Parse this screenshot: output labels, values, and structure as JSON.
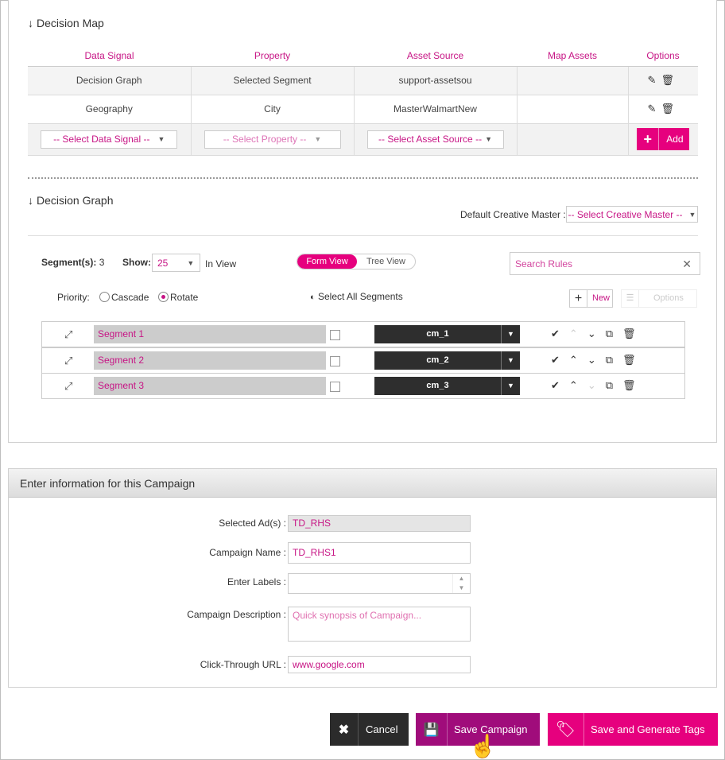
{
  "decision_map": {
    "title": "Decision Map",
    "columns": [
      "Data Signal",
      "Property",
      "Asset Source",
      "Map Assets",
      "Options"
    ],
    "rows": [
      {
        "signal": "Decision Graph",
        "property": "Selected Segment",
        "source": "support-assetsou",
        "map": ""
      },
      {
        "signal": "Geography",
        "property": "City",
        "source": "MasterWalmartNew",
        "map": ""
      }
    ],
    "select_signal": "-- Select Data Signal --",
    "select_property": "-- Select Property --",
    "select_source": "-- Select Asset Source --",
    "add_label": "Add"
  },
  "decision_graph": {
    "title": "Decision Graph",
    "default_master_label": "Default Creative Master :",
    "default_master_value": "-- Select Creative Master --",
    "segments_label": "Segment(s):",
    "segments_count": "3",
    "show_label": "Show:",
    "show_value": "25",
    "in_view": "In View",
    "form_view": "Form View",
    "tree_view": "Tree View",
    "search_placeholder": "Search Rules",
    "priority_label": "Priority:",
    "cascade": "Cascade",
    "rotate": "Rotate",
    "select_all": "Select All Segments",
    "new_label": "New",
    "options_label": "Options",
    "segments": [
      {
        "name": "Segment 1",
        "cm": "cm_1"
      },
      {
        "name": "Segment 2",
        "cm": "cm_2"
      },
      {
        "name": "Segment 3",
        "cm": "cm_3"
      }
    ]
  },
  "campaign": {
    "header": "Enter information for this Campaign",
    "selected_ads_label": "Selected Ad(s) :",
    "selected_ads_value": "TD_RHS",
    "name_label": "Campaign Name :",
    "name_value": "TD_RHS1",
    "labels_label": "Enter Labels :",
    "labels_value": "",
    "desc_label": "Campaign Description :",
    "desc_placeholder": "Quick synopsis of Campaign...",
    "url_label": "Click-Through URL :",
    "url_value": "www.google.com"
  },
  "actions": {
    "cancel": "Cancel",
    "save": "Save Campaign",
    "save_generate": "Save and Generate Tags"
  },
  "colors": {
    "accent": "#e6007e",
    "accent_dark": "#a00c7b",
    "label_magenta": "#c71585"
  }
}
